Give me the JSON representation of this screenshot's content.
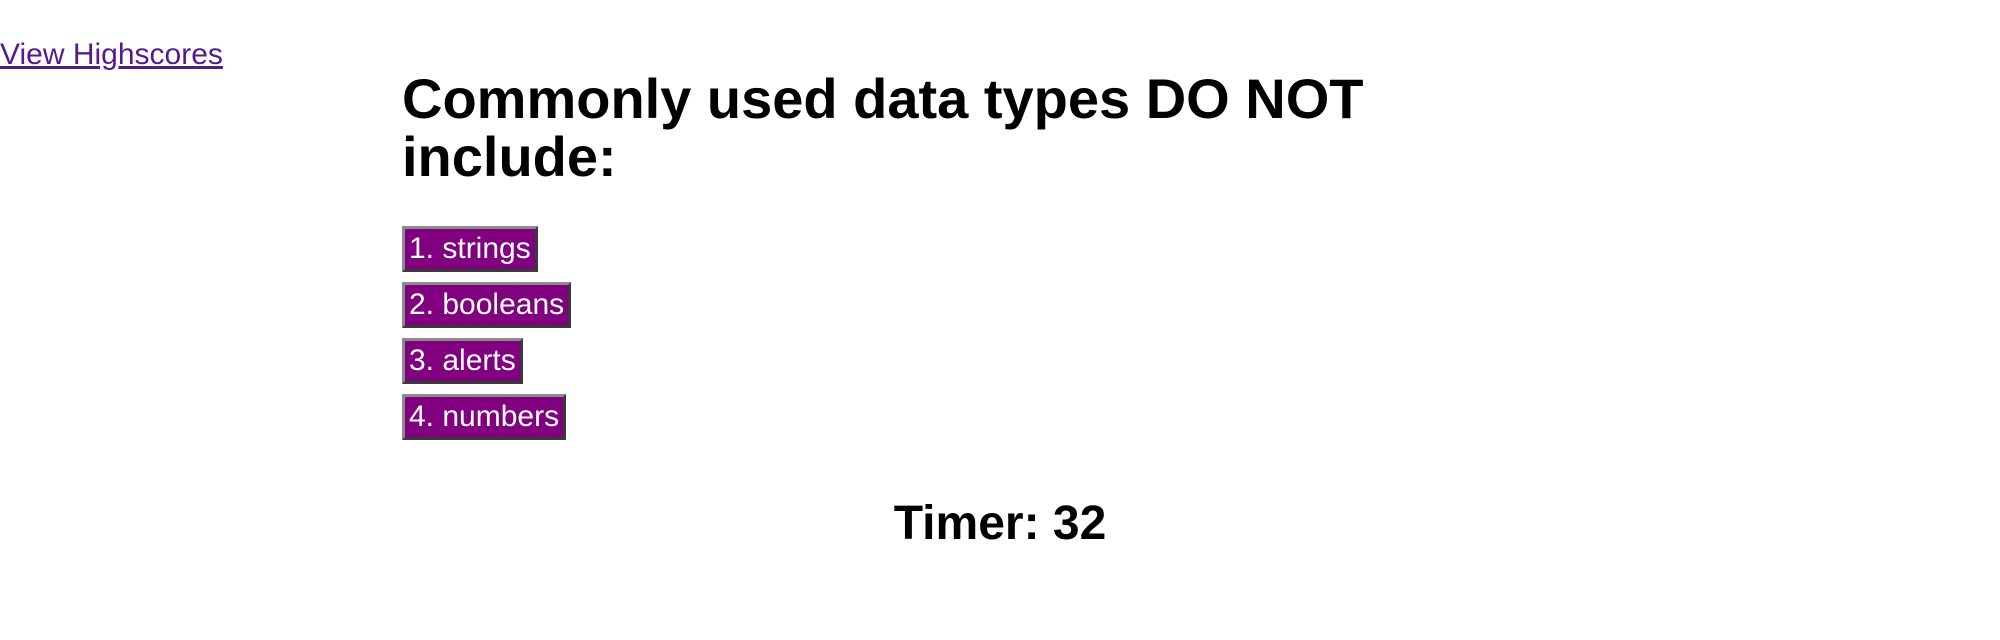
{
  "nav": {
    "highscores_link": "View Highscores",
    "link_color": "#551a8b"
  },
  "quiz": {
    "question": "Commonly used data types DO NOT include:",
    "answers": [
      "1. strings",
      "2. booleans",
      "3. alerts",
      "4. numbers"
    ],
    "button_color": "#800080"
  },
  "timer": {
    "text": "Timer: 32"
  }
}
